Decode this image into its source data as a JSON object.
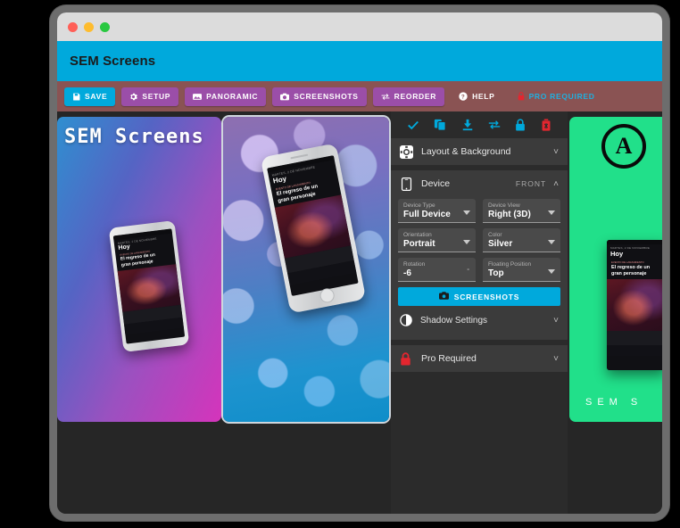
{
  "window": {
    "traffic_lights": [
      "close",
      "minimize",
      "maximize"
    ],
    "app_title": "SEM Screens",
    "header_color": "#00a9dc",
    "toolbar_color": "#8a5353"
  },
  "toolbar": {
    "buttons": [
      {
        "label": "SAVE",
        "icon": "save-icon",
        "style": "cyan"
      },
      {
        "label": "SETUP",
        "icon": "gear-icon",
        "style": "purple"
      },
      {
        "label": "PANORAMIC",
        "icon": "panorama-icon",
        "style": "purple"
      },
      {
        "label": "SCREENSHOTS",
        "icon": "camera-icon",
        "style": "purple"
      },
      {
        "label": "REORDER",
        "icon": "reorder-icon",
        "style": "purple"
      },
      {
        "label": "HELP",
        "icon": "help-icon",
        "style": "flat"
      },
      {
        "label": "PRO REQUIRED",
        "icon": "lock-icon",
        "style": "flat-pro"
      }
    ]
  },
  "cards": [
    {
      "name": "card-gradient",
      "headline": "SEM Screens",
      "bg_start": "#2f8fd0",
      "bg_end": "#d534bb",
      "selected": false
    },
    {
      "name": "card-bokeh",
      "headline": "",
      "bg_start": "#8e6fb0",
      "bg_end": "#0f8ec9",
      "selected": true
    },
    {
      "name": "card-green",
      "logo": "A",
      "footer": "SEM S",
      "bg_start": "#21e08a",
      "bg_end": "#21e08a",
      "selected": false
    }
  ],
  "phone_screen": {
    "date": "MARTES, 2 DE NOVIEMBRE",
    "title": "Hoy",
    "tag": "EVENTO DE LANZAMIENTO",
    "headline_l1": "El regreso de un",
    "headline_l2": "gran personaje"
  },
  "panel": {
    "icons": [
      {
        "name": "check-icon",
        "color": "#00a9dc"
      },
      {
        "name": "duplicate-icon",
        "color": "#00a9dc"
      },
      {
        "name": "download-icon",
        "color": "#00a9dc"
      },
      {
        "name": "reorder-icon",
        "color": "#00a9dc"
      },
      {
        "name": "lock-icon",
        "color": "#00a9dc"
      },
      {
        "name": "trash-icon",
        "color": "#e3262f"
      }
    ],
    "layout_section": {
      "label": "Layout & Background",
      "icon": "layout-icon",
      "chevron": "˅"
    },
    "device_section": {
      "label": "Device",
      "icon": "phone-icon",
      "side_label": "FRONT",
      "chevron": "˄",
      "fields": [
        {
          "label": "Device Type",
          "value": "Full Device",
          "control": "select"
        },
        {
          "label": "Device View",
          "value": "Right (3D)",
          "control": "select"
        },
        {
          "label": "Orientation",
          "value": "Portrait",
          "control": "select"
        },
        {
          "label": "Color",
          "value": "Silver",
          "control": "select"
        },
        {
          "label": "Rotation",
          "value": "-6",
          "control": "number",
          "unit": "°"
        },
        {
          "label": "Floating Position",
          "value": "Top",
          "control": "select"
        }
      ],
      "screenshots_button": "SCREENSHOTS",
      "shadow_settings": {
        "label": "Shadow Settings",
        "icon": "contrast-icon",
        "chevron": "˅"
      }
    },
    "pro_section": {
      "label": "Pro Required",
      "icon": "lock-icon",
      "color": "#e3262f",
      "chevron": "˅"
    }
  }
}
